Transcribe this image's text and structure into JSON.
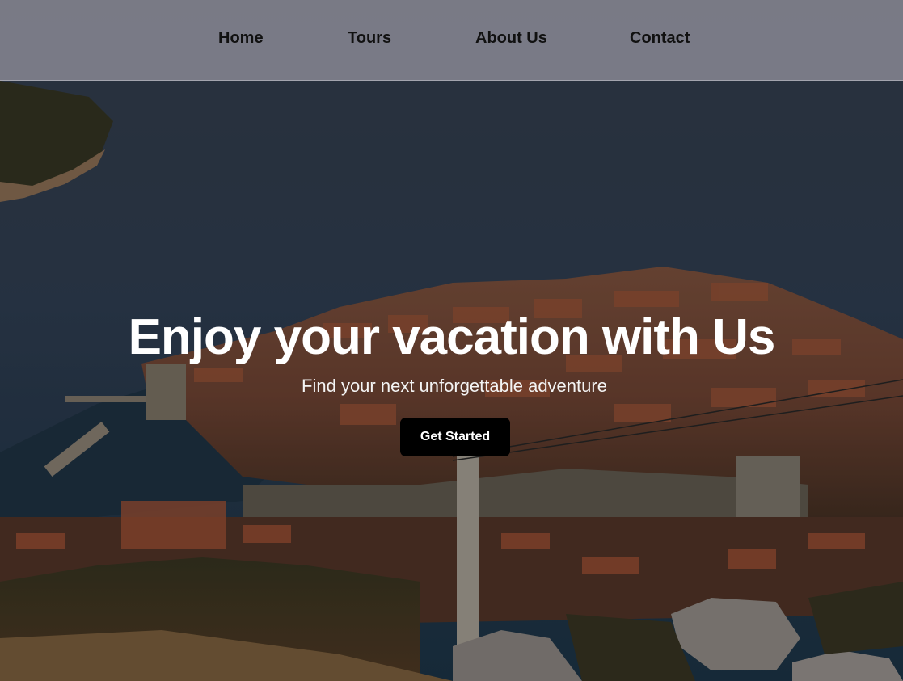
{
  "nav": {
    "items": [
      {
        "label": "Home"
      },
      {
        "label": "Tours"
      },
      {
        "label": "About Us"
      },
      {
        "label": "Contact"
      }
    ]
  },
  "hero": {
    "title": "Enjoy your vacation with Us",
    "subtitle": "Find your next unforgettable adventure",
    "cta_label": "Get Started",
    "background_image": "aerial-coastal-old-town-photo"
  },
  "colors": {
    "nav_background": "#80808c",
    "nav_text": "#111111",
    "hero_text": "#ffffff",
    "cta_background": "#000000",
    "cta_text": "#ffffff"
  }
}
